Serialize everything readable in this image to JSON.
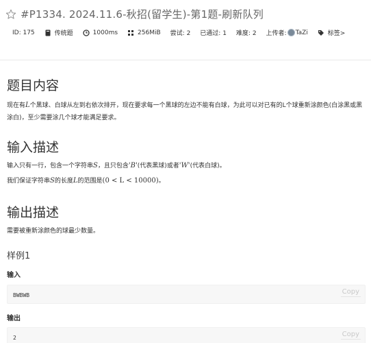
{
  "problem": {
    "title": "#P1334. 2024.11.6-秋招(留学生)-第1题-刷新队列",
    "meta": {
      "id": "ID: 175",
      "type": "传统题",
      "time": "1000ms",
      "memory": "256MiB",
      "tries": "尝试: 2",
      "passed": "已通过: 1",
      "difficulty": "难度: 2",
      "uploader_label": "上传者:",
      "uploader_name": "TaZi",
      "tags": "标签>"
    }
  },
  "sections": {
    "content": {
      "heading": "题目内容",
      "text_a": "现在有",
      "var_L": "L",
      "text_b": "个黑球、白球从左到右依次排开，现在要求每一个黑球的左边不能有白球，为此可以对已有的L个球重新涂颜色(白涂黑或黑涂白)，至少需要涂几个球才能满足要求。"
    },
    "input": {
      "heading": "输入描述",
      "line1_a": "输入只有一行，包含一个字符串",
      "var_S": "S",
      "line1_b": "，且只包含",
      "var_B": "'B'",
      "line1_c": "(代表黑球)或者",
      "var_W": "'W'",
      "line1_d": "(代表白球)。",
      "line2_a": "我们保证字符串",
      "line2_b": "的长度",
      "line2_c": "的范围是",
      "range": "(0 < L < 10000)",
      "line2_d": "。"
    },
    "output": {
      "heading": "输出描述",
      "text": "需要被重新涂颜色的球最少数量。"
    }
  },
  "sample": {
    "heading": "样例1",
    "input_label": "输入",
    "input_value": "BWBWB",
    "output_label": "输出",
    "output_value": "2",
    "copy_label": "Copy"
  }
}
